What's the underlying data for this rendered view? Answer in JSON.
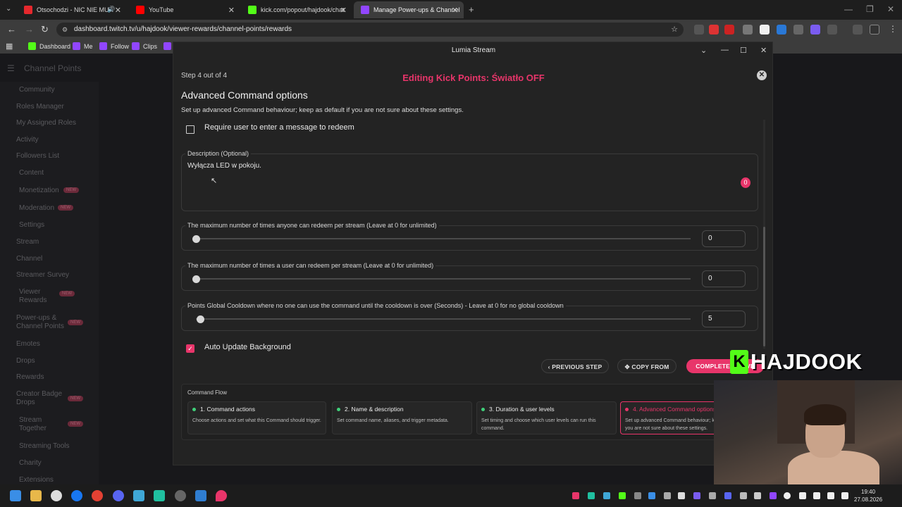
{
  "browser": {
    "tabs": [
      {
        "label": "Otsochodzi - NIC NIE MUA",
        "color": "#e5282d"
      },
      {
        "label": "YouTube",
        "color": "#ff0000"
      },
      {
        "label": "kick.com/popout/hajdook/chat",
        "color": "#53fc18"
      },
      {
        "label": "Manage Power-ups & Channel",
        "color": "#9146ff"
      }
    ],
    "url": "dashboard.twitch.tv/u/hajdook/viewer-rewards/channel-points/rewards",
    "bookmarks": [
      {
        "label": "Dashboard",
        "color": "#53fc18"
      },
      {
        "label": "Me",
        "color": "#9146ff"
      },
      {
        "label": "Follow",
        "color": "#9146ff"
      },
      {
        "label": "Clips",
        "color": "#9146ff"
      }
    ]
  },
  "twitch": {
    "title": "Channel Points",
    "sidebar": [
      {
        "label": "Community"
      },
      {
        "label": "Roles Manager"
      },
      {
        "label": "My Assigned Roles"
      },
      {
        "label": "Activity"
      },
      {
        "label": "Followers List"
      },
      {
        "label": "Content"
      },
      {
        "label": "Monetization",
        "badge": "NEW"
      },
      {
        "label": "Moderation",
        "badge": "NEW"
      },
      {
        "label": "Settings"
      },
      {
        "label": "Stream"
      },
      {
        "label": "Channel"
      },
      {
        "label": "Streamer Survey"
      },
      {
        "label": "Viewer Rewards",
        "badge": "NEW"
      },
      {
        "label": "Power-ups & Channel Points",
        "badge": "NEW"
      },
      {
        "label": "Emotes"
      },
      {
        "label": "Drops"
      },
      {
        "label": "Rewards"
      },
      {
        "label": "Creator Badge Drops",
        "badge": "NEW"
      },
      {
        "label": "Stream Together",
        "badge": "NEW"
      },
      {
        "label": "Streaming Tools"
      },
      {
        "label": "Charity"
      },
      {
        "label": "Extensions"
      }
    ]
  },
  "lumia": {
    "window_title": "Lumia Stream",
    "step": "Step 4 out of 4",
    "editing_title": "Editing Kick Points: Światło OFF",
    "section_title": "Advanced Command options",
    "section_subtitle": "Set up advanced Command behaviour; keep as default if you are not sure about these settings.",
    "require_message_label": "Require user to enter a message to redeem",
    "require_message_checked": false,
    "description_legend": "Description (Optional)",
    "description_value": "Wyłącza LED w pokoju.",
    "description_count": "0",
    "sliders": [
      {
        "label": "The maximum number of times anyone can redeem per stream (Leave at 0 for unlimited)",
        "value": "0",
        "fraction": 0
      },
      {
        "label": "The maximum number of times a user can redeem per stream (Leave at 0 for unlimited)",
        "value": "0",
        "fraction": 0
      },
      {
        "label": "Points Global Cooldown where no one can use the command until the cooldown is over (Seconds) - Leave at 0 for no global cooldown",
        "value": "5",
        "fraction": 0.008
      }
    ],
    "auto_update_label": "Auto Update Background",
    "auto_update_checked": true,
    "buttons": {
      "previous": "PREVIOUS STEP",
      "copy_from": "COPY FROM",
      "complete": "COMPLETE & SAVE"
    },
    "flow": {
      "title": "Command Flow",
      "steps": [
        {
          "title": "1. Command actions",
          "desc": "Choose actions and set what this Command should trigger."
        },
        {
          "title": "2. Name & description",
          "desc": "Set command name, aliases, and trigger metadata."
        },
        {
          "title": "3. Duration & user levels",
          "desc": "Set timing and choose which user levels can run this command."
        },
        {
          "title": "4. Advanced Command options",
          "desc": "Set up advanced Command behaviour; keep as default if you are not sure about these settings."
        }
      ]
    }
  },
  "overlay": {
    "brand_letter": "K",
    "brand_name": "HAJDOOK",
    "accent": "#53fc18"
  },
  "taskbar": {
    "time": "19:40",
    "date": "27.08.2026"
  },
  "colors": {
    "accent": "#e8356a"
  }
}
